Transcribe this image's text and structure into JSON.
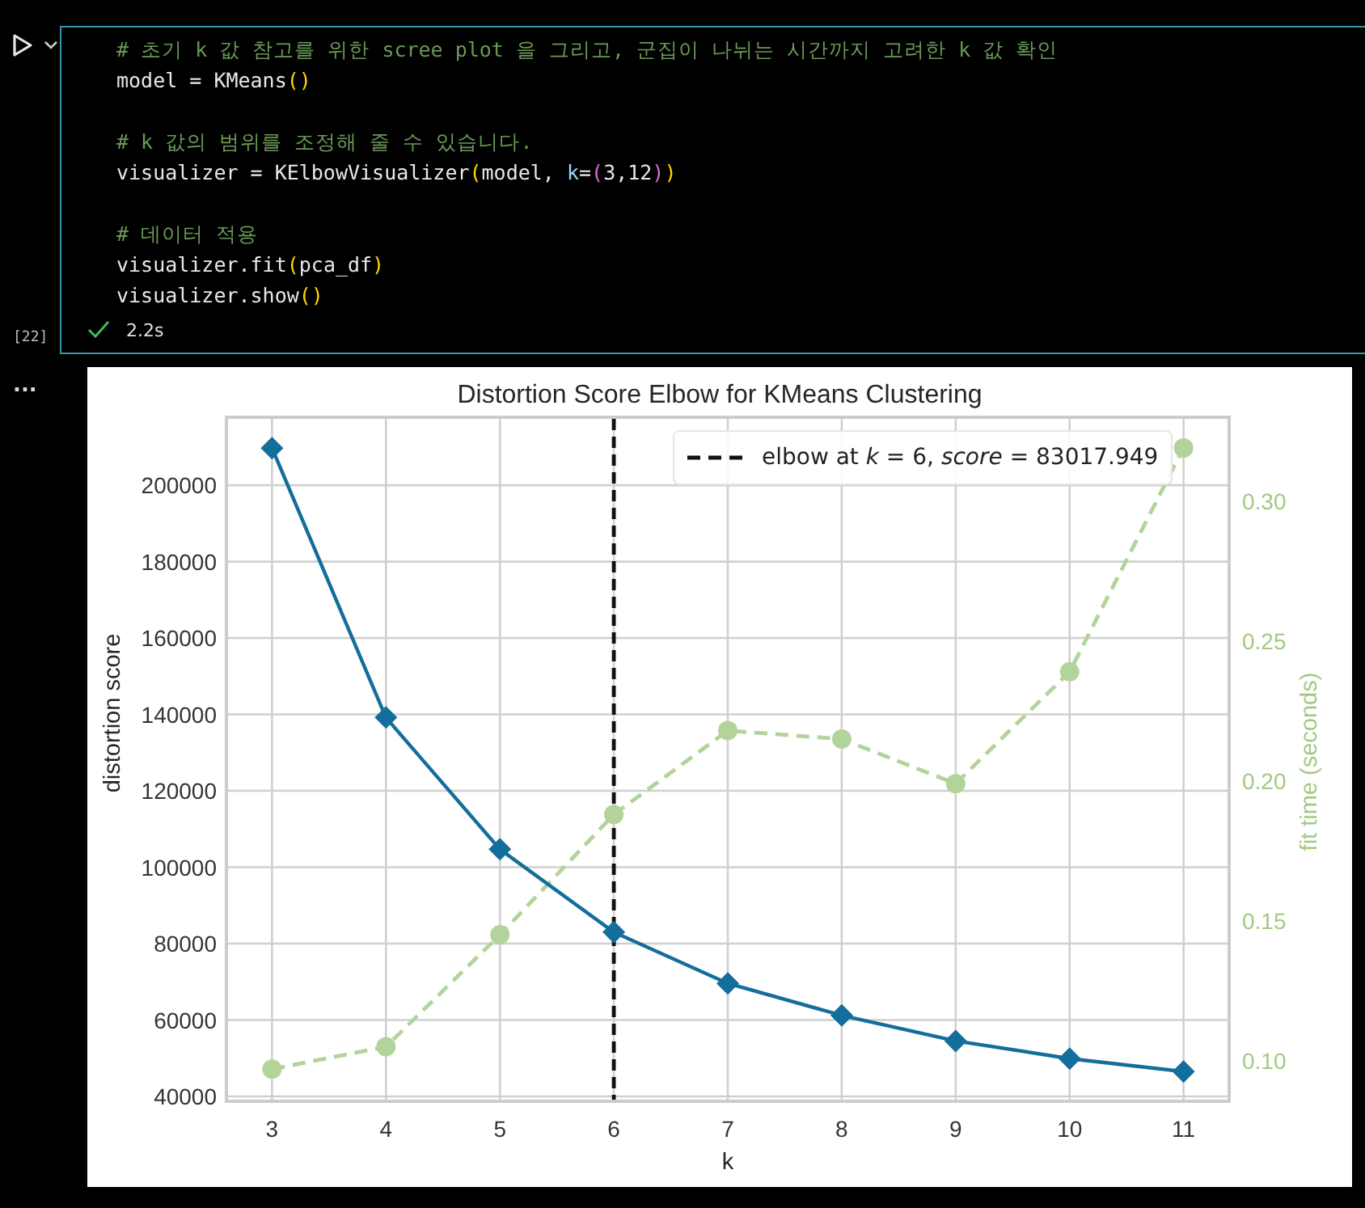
{
  "cell": {
    "execution_count": "[22]",
    "status": {
      "kind": "success",
      "duration": "2.2s"
    },
    "code_blocks": [
      [
        [
          {
            "kind": "comment",
            "text": "# 초기 k 값 참고를 위한 scree plot 을 그리고, 군집이 나뉘는 시간까지 고려한 k 값 확인"
          }
        ],
        [
          {
            "kind": "plain",
            "text": "model = KMeans"
          },
          {
            "kind": "paren1",
            "text": "()"
          }
        ]
      ],
      [
        [
          {
            "kind": "comment",
            "text": "# k 값의 범위를 조정해 줄 수 있습니다."
          }
        ],
        [
          {
            "kind": "plain",
            "text": "visualizer = KElbowVisualizer"
          },
          {
            "kind": "paren1",
            "text": "("
          },
          {
            "kind": "plain",
            "text": "model, "
          },
          {
            "kind": "param",
            "text": "k"
          },
          {
            "kind": "plain",
            "text": "="
          },
          {
            "kind": "paren2",
            "text": "("
          },
          {
            "kind": "plain",
            "text": "3,12"
          },
          {
            "kind": "paren2",
            "text": ")"
          },
          {
            "kind": "paren1",
            "text": ")"
          }
        ]
      ],
      [
        [
          {
            "kind": "comment",
            "text": "# 데이터 적용"
          }
        ],
        [
          {
            "kind": "plain",
            "text": "visualizer.fit"
          },
          {
            "kind": "paren1",
            "text": "("
          },
          {
            "kind": "plain",
            "text": "pca_df"
          },
          {
            "kind": "paren1",
            "text": ")"
          }
        ],
        [
          {
            "kind": "plain",
            "text": "visualizer.show"
          },
          {
            "kind": "paren1",
            "text": "()"
          }
        ]
      ]
    ]
  },
  "output": {
    "menu": "...",
    "chart_data": {
      "type": "line",
      "title": "Distortion Score Elbow for KMeans Clustering",
      "xlabel": "k",
      "ylabel": "distortion score",
      "y2label": "fit time (seconds)",
      "x": [
        3,
        4,
        5,
        6,
        7,
        8,
        9,
        10,
        11
      ],
      "xlim": [
        2.6,
        11.4
      ],
      "ylim": [
        38730,
        217800
      ],
      "y2lim": [
        0.0855,
        0.33
      ],
      "xticks": [
        3,
        4,
        5,
        6,
        7,
        8,
        9,
        10,
        11
      ],
      "yticks": [
        40000,
        60000,
        80000,
        100000,
        120000,
        140000,
        160000,
        180000,
        200000
      ],
      "y2ticks": [
        {
          "value": 0.1,
          "label": "0.10"
        },
        {
          "value": 0.15,
          "label": "0.15"
        },
        {
          "value": 0.2,
          "label": "0.20"
        },
        {
          "value": 0.25,
          "label": "0.25"
        },
        {
          "value": 0.3,
          "label": "0.30"
        }
      ],
      "series": [
        {
          "color": "#136e9c",
          "marker": "diamond",
          "line_style": "solid",
          "values": [
            209700,
            139200,
            104700,
            83000,
            69600,
            61200,
            54500,
            49900,
            46500
          ]
        },
        {
          "color": "#b2d49a",
          "axis": "y2",
          "marker": "circle",
          "line_style": "dashed",
          "values": [
            0.097,
            0.105,
            0.145,
            0.188,
            0.218,
            0.215,
            0.199,
            0.239,
            0.319
          ]
        }
      ],
      "grid": true,
      "ref_lines": [
        {
          "axis": "x",
          "value": 6,
          "color": "#111111",
          "line_style": "dashed"
        }
      ]
    },
    "legend": "elbow at *k* = 6, *score* = 83017.949"
  }
}
